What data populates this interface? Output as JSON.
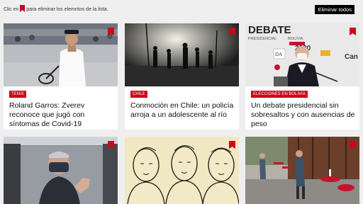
{
  "toolbar": {
    "hint_before": "Clic en",
    "hint_after": "para eliminar los elemntos de la lista.",
    "clear_all_label": "Eliminar todos"
  },
  "colors": {
    "accent": "#d0011b",
    "button_bg": "#000000",
    "page_bg": "#efefef"
  },
  "icons": {
    "bookmark": "bookmark-icon"
  },
  "cards": [
    {
      "tag": "Tenis",
      "title": "Roland Garros: Zverev reconoce que jugó con síntomas de Covid-19",
      "image": "tennis-player"
    },
    {
      "tag": "Chile",
      "title": "Conmoción en Chile: un policía arroja a un adolescente al río",
      "image": "protest-smoke"
    },
    {
      "tag": "Elecciones en Bolivia",
      "title": "Un debate presidencial sin sobresaltos y con ausencias de peso",
      "image": "debate-speaker",
      "image_text": {
        "line1": "DEBATE",
        "line2": "PRESIDENCIAL",
        "line3": "BOLIVIA",
        "year": "2020",
        "badge": "DA",
        "side": "Can"
      }
    },
    {
      "tag": "",
      "title": "",
      "image": "man-in-car"
    },
    {
      "tag": "",
      "title": "",
      "image": "nobel-portraits"
    },
    {
      "tag": "",
      "title": "",
      "image": "street-cafe"
    }
  ]
}
